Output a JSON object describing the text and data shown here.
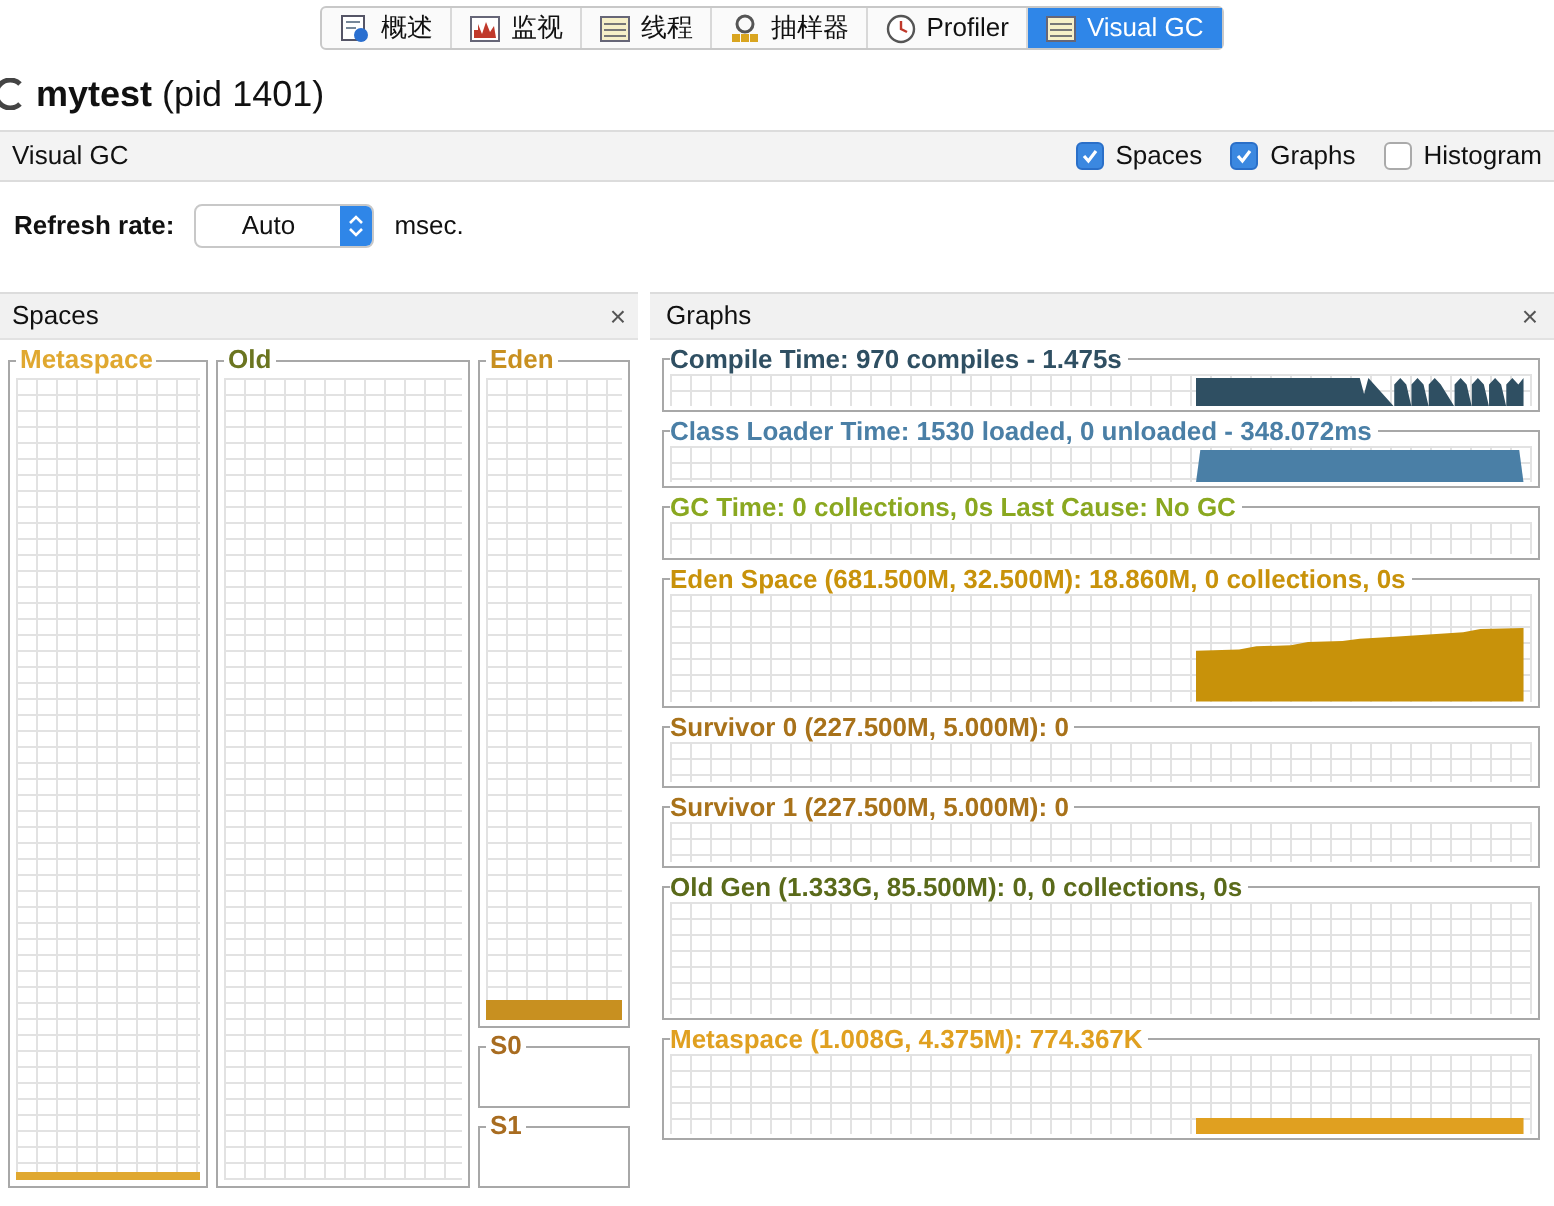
{
  "tabs": [
    {
      "label": "概述",
      "selected": false
    },
    {
      "label": "监视",
      "selected": false
    },
    {
      "label": "线程",
      "selected": false
    },
    {
      "label": "抽样器",
      "selected": false
    },
    {
      "label": "Profiler",
      "selected": false
    },
    {
      "label": "Visual GC",
      "selected": true
    }
  ],
  "title": {
    "name": "mytest",
    "pid": "(pid 1401)"
  },
  "toolbar": {
    "title": "Visual GC",
    "options": [
      {
        "label": "Spaces",
        "checked": true
      },
      {
        "label": "Graphs",
        "checked": true
      },
      {
        "label": "Histogram",
        "checked": false
      }
    ]
  },
  "refresh": {
    "label": "Refresh rate:",
    "value": "Auto",
    "unit": "msec."
  },
  "spaces": {
    "title": "Spaces",
    "close": "×",
    "columns": [
      {
        "name": "Metaspace",
        "color": "#e0a830",
        "level": 0.01
      },
      {
        "name": "Old",
        "color": "#6b7520"
      }
    ],
    "young": [
      {
        "name": "Eden",
        "color": "#c89020",
        "level": 0.03
      },
      {
        "name": "S0",
        "color": "#a86c20"
      },
      {
        "name": "S1",
        "color": "#a86c20"
      }
    ]
  },
  "graphs": {
    "title": "Graphs",
    "close": "×",
    "items": [
      {
        "label": "Compile Time: 970 compiles - 1.475s",
        "color": "#2f4f62",
        "kind": "spikes"
      },
      {
        "label": "Class Loader Time: 1530 loaded, 0 unloaded - 348.072ms",
        "color": "#4a7fa6",
        "kind": "block"
      },
      {
        "label": "GC Time: 0 collections, 0s Last Cause: No GC",
        "color": "#8aa820",
        "kind": "flat"
      },
      {
        "label": "Eden Space (681.500M, 32.500M): 18.860M, 0 collections, 0s",
        "color": "#c8920a",
        "kind": "ramp"
      },
      {
        "label": "Survivor 0 (227.500M, 5.000M): 0",
        "color": "#a8721a",
        "kind": "flat"
      },
      {
        "label": "Survivor 1 (227.500M, 5.000M): 0",
        "color": "#a8721a",
        "kind": "flat"
      },
      {
        "label": "Old Gen (1.333G, 85.500M): 0, 0 collections, 0s",
        "color": "#5a6a1a",
        "kind": "flat"
      },
      {
        "label": "Metaspace (1.008G, 4.375M): 774.367K",
        "color": "#e0a020",
        "kind": "line"
      }
    ]
  }
}
